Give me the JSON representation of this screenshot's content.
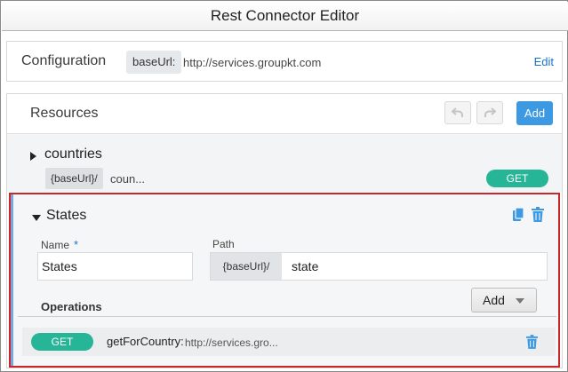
{
  "window": {
    "title": "Rest Connector Editor"
  },
  "configuration": {
    "label": "Configuration",
    "base_url_key": "baseUrl:",
    "base_url_value": "http://services.groupkt.com",
    "edit_label": "Edit"
  },
  "resources": {
    "title": "Resources",
    "add_label": "Add",
    "icons": {
      "undo": "undo-icon",
      "redo": "redo-icon"
    },
    "items": [
      {
        "name": "countries",
        "expanded": false,
        "base_chip": "{baseUrl}/",
        "path_preview": "coun...",
        "method": "GET"
      },
      {
        "name": "States",
        "expanded": true,
        "selected": true,
        "fields": {
          "name_label": "Name",
          "required_marker": "*",
          "name_value": "States",
          "path_label": "Path",
          "base_chip": "{baseUrl}/",
          "path_value": "state"
        },
        "operations": {
          "label": "Operations",
          "add_label": "Add",
          "items": [
            {
              "method": "GET",
              "name": "getForCountry:",
              "url_preview": "http://services.gro..."
            }
          ]
        }
      }
    ]
  },
  "colors": {
    "accent_blue": "#3d9ae2",
    "get_badge": "#27b597",
    "selection_border": "#c8262b",
    "selected_left_bar": "#79a7e0"
  }
}
